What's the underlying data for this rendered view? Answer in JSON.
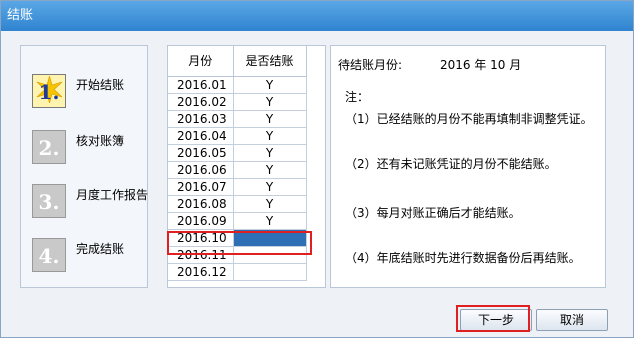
{
  "window": {
    "title": "结账"
  },
  "steps": [
    {
      "number": "1.",
      "label": "开始结账",
      "active": true
    },
    {
      "number": "2.",
      "label": "核对账簿",
      "active": false
    },
    {
      "number": "3.",
      "label": "月度工作报告",
      "active": false
    },
    {
      "number": "4.",
      "label": "完成结账",
      "active": false
    }
  ],
  "table": {
    "headers": [
      "月份",
      "是否结账"
    ],
    "rows": [
      {
        "month": "2016.01",
        "closed": "Y"
      },
      {
        "month": "2016.02",
        "closed": "Y"
      },
      {
        "month": "2016.03",
        "closed": "Y"
      },
      {
        "month": "2016.04",
        "closed": "Y"
      },
      {
        "month": "2016.05",
        "closed": "Y"
      },
      {
        "month": "2016.06",
        "closed": "Y"
      },
      {
        "month": "2016.07",
        "closed": "Y"
      },
      {
        "month": "2016.08",
        "closed": "Y"
      },
      {
        "month": "2016.09",
        "closed": "Y"
      },
      {
        "month": "2016.10",
        "closed": "",
        "selected": true
      },
      {
        "month": "2016.11",
        "closed": ""
      },
      {
        "month": "2016.12",
        "closed": ""
      }
    ]
  },
  "notes": {
    "await_label": "待结账月份:",
    "await_value": "2016 年 10 月",
    "title": "注：",
    "items": [
      "（1）已经结账的月份不能再填制非调整凭证。",
      "（2）还有未记账凭证的月份不能结账。",
      "（3）每月对账正确后才能结账。",
      "（4）年底结账时先进行数据备份后再结账。"
    ]
  },
  "buttons": {
    "next": "下一步",
    "cancel": "取消"
  },
  "colors": {
    "titlebar": "#3b8fd8",
    "selection": "#2f6fb5",
    "highlight_box": "#e02020"
  }
}
